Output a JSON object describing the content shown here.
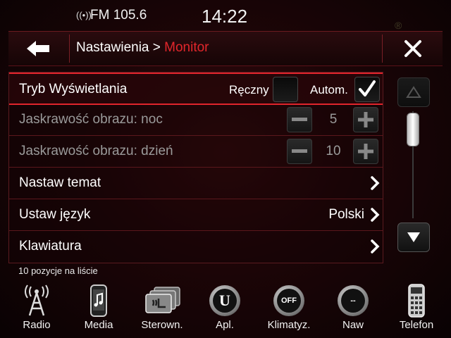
{
  "status": {
    "radio_icon": "radio-signal-icon",
    "radio_text": "FM 105.6",
    "clock": "14:22"
  },
  "header": {
    "back_icon": "back-arrow-icon",
    "crumb_parent": "Nastawienia >",
    "crumb_current": "Monitor",
    "close_icon": "close-icon",
    "accent_color": "#e2262b"
  },
  "list": {
    "display_mode": {
      "label": "Tryb Wyświetlania",
      "manual_label": "Ręczny",
      "manual_checked": false,
      "auto_label": "Autom.",
      "auto_checked": true
    },
    "brightness_night": {
      "label": "Jaskrawość obrazu: noc",
      "value": "5"
    },
    "brightness_day": {
      "label": "Jaskrawość obrazu: dzień",
      "value": "10"
    },
    "theme": {
      "label": "Nastaw temat"
    },
    "language": {
      "label": "Ustaw język",
      "value": "Polski"
    },
    "keyboard": {
      "label": "Klawiatura"
    }
  },
  "scroll": {
    "position_fraction": 0.0
  },
  "count_text": "10 pozycje na liście",
  "dock": [
    {
      "label": "Radio",
      "icon": "radio-tower-icon"
    },
    {
      "label": "Media",
      "icon": "media-phone-icon"
    },
    {
      "label": "Sterown.",
      "icon": "seat-heat-icon"
    },
    {
      "label": "Apl.",
      "icon": "uconnect-icon"
    },
    {
      "label": "Klimatyz.",
      "icon": "climate-off-icon",
      "badge": "OFF"
    },
    {
      "label": "Naw",
      "icon": "navigation-compass-icon",
      "badge": "--"
    },
    {
      "label": "Telefon",
      "icon": "phone-keypad-icon"
    }
  ]
}
